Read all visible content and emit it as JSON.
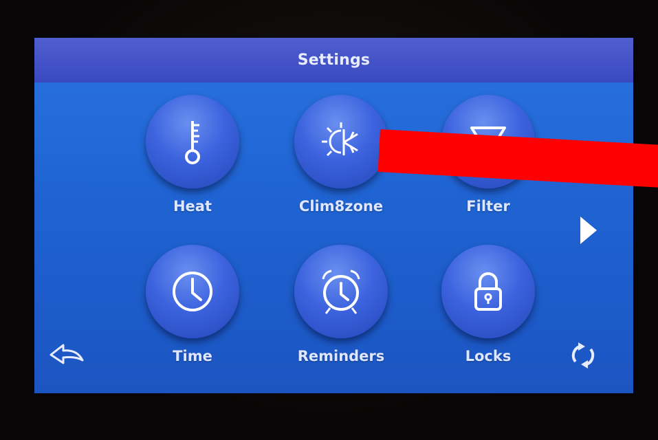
{
  "title": "Settings",
  "tiles": [
    {
      "label": "Heat",
      "icon": "thermometer-icon"
    },
    {
      "label": "Clim8zone",
      "icon": "sun-snowflake-icon"
    },
    {
      "label": "Filter",
      "icon": "filter-icon"
    },
    {
      "label": "Time",
      "icon": "clock-icon"
    },
    {
      "label": "Reminders",
      "icon": "alarm-clock-icon"
    },
    {
      "label": "Locks",
      "icon": "padlock-icon"
    }
  ],
  "colors": {
    "screen": "#1f63d2",
    "titlebar": "#3a49c0",
    "label": "#dfe6ff",
    "annotation": "#ff0000"
  }
}
